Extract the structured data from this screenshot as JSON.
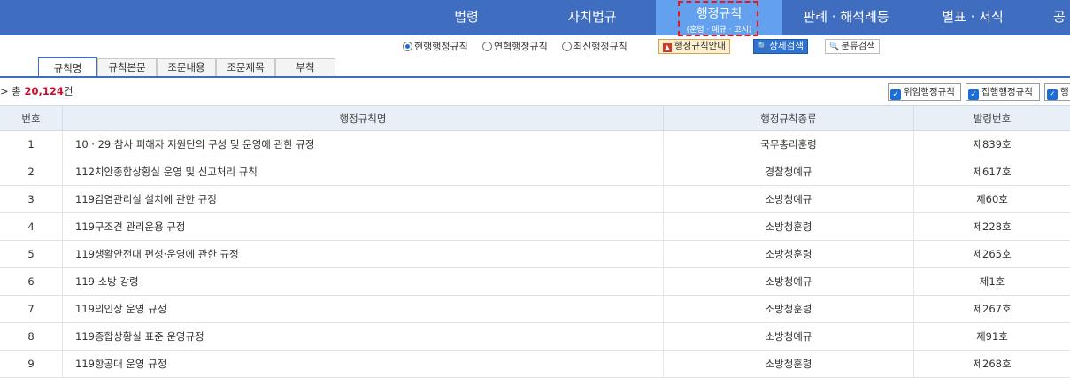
{
  "nav": {
    "items": [
      "법령",
      "자치법규",
      "판례 · 해석례등",
      "별표 · 서식",
      "공"
    ],
    "active_title": "행정규칙",
    "active_subtitle": "(훈령 · 예규 · 고시)"
  },
  "options": {
    "radios": [
      "현행행정규칙",
      "연혁행정규칙",
      "최신행정규칙"
    ],
    "selected": 0,
    "guide_button": "행정규칙안내",
    "detail_button": "상세검색",
    "class_button": "분류검색"
  },
  "tabs": [
    "규칙명",
    "규칙본문",
    "조문내용",
    "조문제목",
    "부칙"
  ],
  "summary": {
    "prefix": "> 총 ",
    "count": "20,124",
    "suffix": "건"
  },
  "filters": [
    "위임행정규칙",
    "집행행정규칙",
    "행"
  ],
  "table": {
    "columns": [
      "번호",
      "행정규칙명",
      "행정규칙종류",
      "발령번호"
    ],
    "rows": [
      {
        "no": "1",
        "name": "10 · 29 참사 피해자 지원단의 구성 및 운영에 관한 규정",
        "kind": "국무총리훈령",
        "number": "제839호"
      },
      {
        "no": "2",
        "name": "112치안종합상황실 운영 및 신고처리 규칙",
        "kind": "경찰청예규",
        "number": "제617호"
      },
      {
        "no": "3",
        "name": "119감염관리실 설치에 관한 규정",
        "kind": "소방청예규",
        "number": "제60호"
      },
      {
        "no": "4",
        "name": "119구조견 관리운용 규정",
        "kind": "소방청훈령",
        "number": "제228호"
      },
      {
        "no": "5",
        "name": "119생활안전대 편성·운영에 관한 규정",
        "kind": "소방청훈령",
        "number": "제265호"
      },
      {
        "no": "6",
        "name": "119 소방 강령",
        "kind": "소방청예규",
        "number": "제1호"
      },
      {
        "no": "7",
        "name": "119의인상 운영 규정",
        "kind": "소방청훈령",
        "number": "제267호"
      },
      {
        "no": "8",
        "name": "119종합상황실 표준 운영규정",
        "kind": "소방청예규",
        "number": "제91호"
      },
      {
        "no": "9",
        "name": "119항공대 운영 규정",
        "kind": "소방청훈령",
        "number": "제268호"
      }
    ]
  },
  "colors": {
    "nav_bg": "#3f6dbf",
    "nav_active": "#63a1ee",
    "count": "#c8102e",
    "highlight_border": "#e3171e"
  }
}
